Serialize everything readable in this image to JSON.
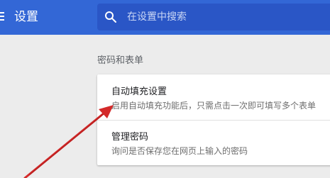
{
  "header": {
    "title": "设置",
    "menu_icon": "hamburger-menu-icon",
    "background_color": "#3367d6"
  },
  "search": {
    "placeholder": "在设置中搜索",
    "icon": "search-icon"
  },
  "section": {
    "heading": "密码和表单",
    "items": [
      {
        "title": "自动填充设置",
        "description": "启用自动填充功能后，只需点击一次即可填写多个表单"
      },
      {
        "title": "管理密码",
        "description": "询问是否保存您在网页上输入的密码"
      }
    ]
  },
  "annotation": {
    "type": "arrow",
    "color": "#cc2222",
    "points_to": "自动填充设置"
  }
}
